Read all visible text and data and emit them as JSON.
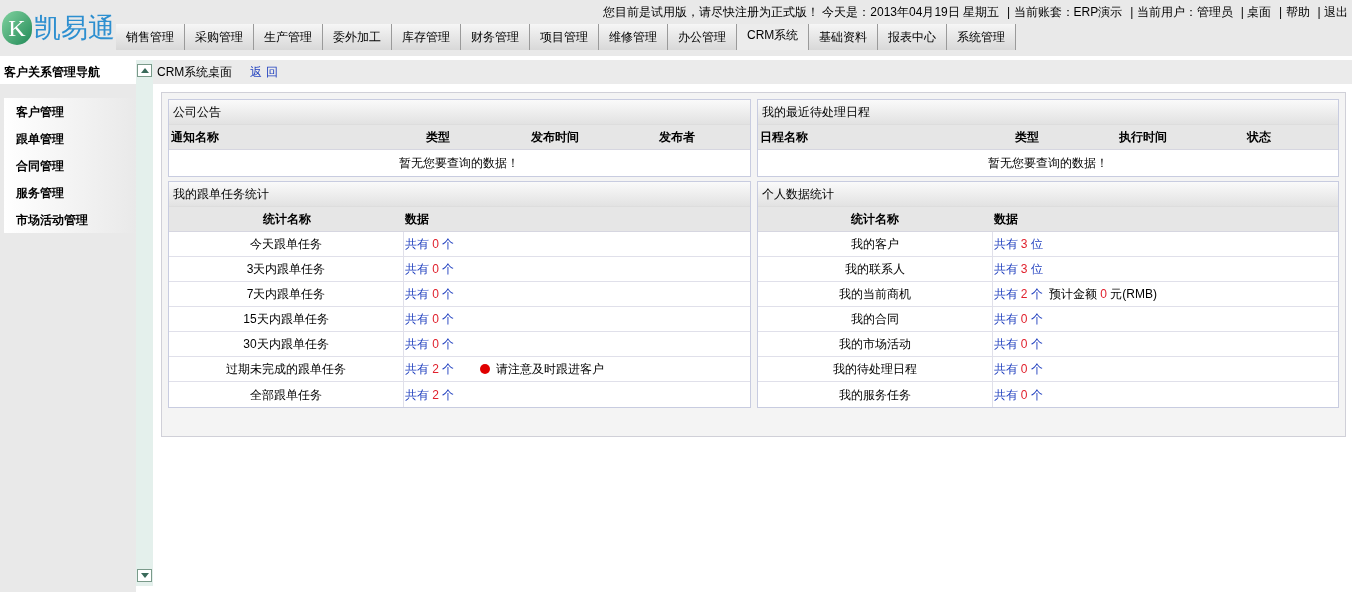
{
  "logo": {
    "letter": "K",
    "name": "凯易通"
  },
  "top_bar": {
    "notice": "您目前是试用版，请尽快注册为正式版！ 今天是：2013年04月19日  星期五",
    "info": [
      "| 当前账套：ERP演示",
      "| 当前用户：管理员"
    ],
    "links": [
      "| 桌面",
      "| 帮助",
      "| 退出"
    ]
  },
  "nav_tabs": [
    {
      "label": "销售管理",
      "selected": false
    },
    {
      "label": "采购管理",
      "selected": false
    },
    {
      "label": "生产管理",
      "selected": false
    },
    {
      "label": "委外加工",
      "selected": false
    },
    {
      "label": "库存管理",
      "selected": false
    },
    {
      "label": "财务管理",
      "selected": false
    },
    {
      "label": "项目管理",
      "selected": false
    },
    {
      "label": "维修管理",
      "selected": false
    },
    {
      "label": "办公管理",
      "selected": false
    },
    {
      "label": "CRM系统",
      "selected": true
    },
    {
      "label": "基础资料",
      "selected": false
    },
    {
      "label": "报表中心",
      "selected": false
    },
    {
      "label": "系统管理",
      "selected": false
    }
  ],
  "sidebar": {
    "title": "客户关系管理导航",
    "items": [
      "客户管理",
      "跟单管理",
      "合同管理",
      "服务管理",
      "市场活动管理"
    ]
  },
  "breadcrumb": {
    "title": "CRM系统桌面",
    "back": "返 回"
  },
  "panels": [
    {
      "kind": "list",
      "title": "公司公告",
      "columns": [
        "通知名称",
        "类型",
        "发布时间",
        "发布者"
      ],
      "empty": "暂无您要查询的数据！"
    },
    {
      "kind": "list",
      "title": "我的最近待处理日程",
      "columns": [
        "日程名称",
        "类型",
        "执行时间",
        "状态"
      ],
      "empty": "暂无您要查询的数据！"
    },
    {
      "kind": "stats",
      "title": "我的跟单任务统计",
      "columns": [
        "统计名称",
        "数据"
      ],
      "rows": [
        {
          "name": "今天跟单任务",
          "lead": "共有",
          "count": "0",
          "unit": "个"
        },
        {
          "name": "3天内跟单任务",
          "lead": "共有",
          "count": "0",
          "unit": "个"
        },
        {
          "name": "7天内跟单任务",
          "lead": "共有",
          "count": "0",
          "unit": "个"
        },
        {
          "name": "15天内跟单任务",
          "lead": "共有",
          "count": "0",
          "unit": "个"
        },
        {
          "name": "30天内跟单任务",
          "lead": "共有",
          "count": "0",
          "unit": "个"
        },
        {
          "name": "过期未完成的跟单任务",
          "lead": "共有",
          "count": "2",
          "unit": "个",
          "alert": "请注意及时跟进客户"
        },
        {
          "name": "全部跟单任务",
          "lead": "共有",
          "count": "2",
          "unit": "个"
        }
      ]
    },
    {
      "kind": "stats",
      "title": "个人数据统计",
      "columns": [
        "统计名称",
        "数据"
      ],
      "rows": [
        {
          "name": "我的客户",
          "lead": "共有",
          "count": "3",
          "unit": "位"
        },
        {
          "name": "我的联系人",
          "lead": "共有",
          "count": "3",
          "unit": "位"
        },
        {
          "name": "我的当前商机",
          "lead": "共有",
          "count": "2",
          "unit": "个",
          "extra": {
            "label": "预计金额",
            "count": "0",
            "unit": "元(RMB)"
          }
        },
        {
          "name": "我的合同",
          "lead": "共有",
          "count": "0",
          "unit": "个"
        },
        {
          "name": "我的市场活动",
          "lead": "共有",
          "count": "0",
          "unit": "个"
        },
        {
          "name": "我的待处理日程",
          "lead": "共有",
          "count": "0",
          "unit": "个"
        },
        {
          "name": "我的服务任务",
          "lead": "共有",
          "count": "0",
          "unit": "个"
        }
      ]
    }
  ]
}
